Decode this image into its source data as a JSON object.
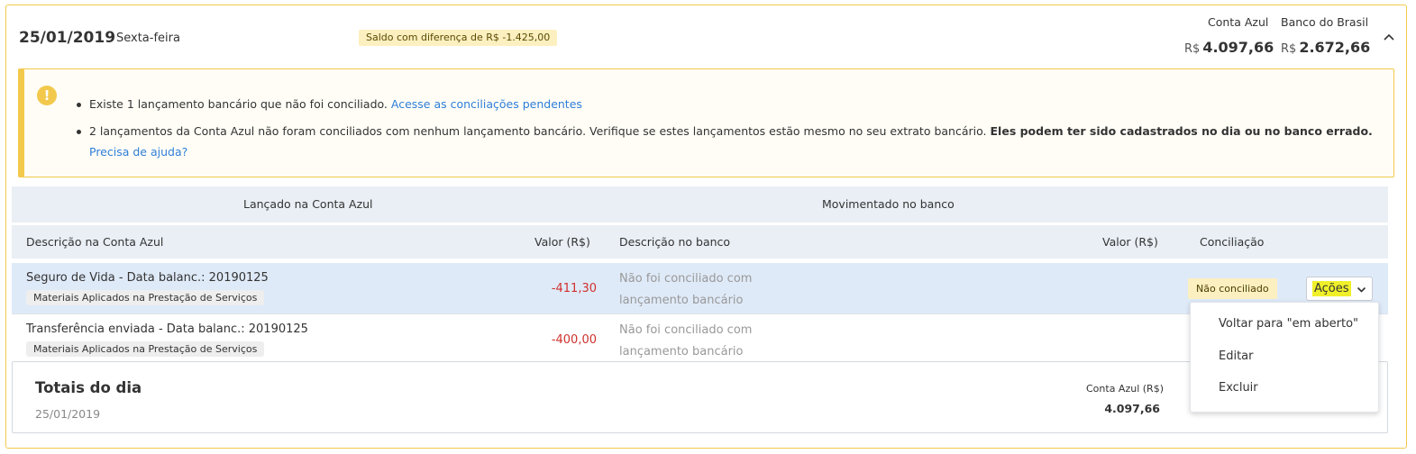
{
  "header": {
    "date": "25/01/2019",
    "weekday": "Sexta-feira",
    "difference_badge": "Saldo com diferença de R$ -1.425,00",
    "balances": [
      {
        "label": "Conta Azul",
        "currency": "R$",
        "value": "4.097,66"
      },
      {
        "label": "Banco do Brasil",
        "currency": "R$",
        "value": "2.672,66"
      }
    ],
    "collapse_icon": "chevron-up-icon"
  },
  "alert": {
    "icon": "exclamation-icon",
    "item1_text": "Existe 1 lançamento bancário que não foi conciliado.",
    "item1_link": "Acesse as conciliações pendentes",
    "item2_text": "2 lançamentos da Conta Azul não foram conciliados com nenhum lançamento bancário. Verifique se estes lançamentos estão mesmo no seu extrato bancário.",
    "item2_bold": "Eles podem ter sido cadastrados no dia ou no banco errado.",
    "item2_link": "Precisa de ajuda?"
  },
  "table": {
    "group_headers": [
      "Lançado na Conta Azul",
      "Movimentado no banco"
    ],
    "columns": [
      "Descrição na Conta Azul",
      "Valor (R$)",
      "Descrição no banco",
      "Valor (R$)",
      "Conciliação"
    ],
    "rows": [
      {
        "description": "Seguro de Vida - Data balanc.: 20190125",
        "category": "Materiais Aplicados na Prestação de Serviços",
        "value": "-411,30",
        "bank_desc_line1": "Não foi conciliado com",
        "bank_desc_line2": "lançamento bancário",
        "status": "Não conciliado",
        "actions_label": "Ações"
      },
      {
        "description": "Transferência enviada - Data balanc.: 20190125",
        "category": "Materiais Aplicados na Prestação de Serviços",
        "value": "-400,00",
        "bank_desc_line1": "Não foi conciliado com",
        "bank_desc_line2": "lançamento bancário"
      }
    ]
  },
  "totals": {
    "title": "Totais do dia",
    "date": "25/01/2019",
    "conta_azul_label": "Conta Azul (R$)",
    "conta_azul_value": "4.097,66"
  },
  "actions_menu": {
    "items": [
      "Voltar para \"em aberto\"",
      "Editar",
      "Excluir"
    ]
  },
  "colors": {
    "accent_yellow": "#f2c94c",
    "negative_red": "#d0312d",
    "link_blue": "#2f7ed8",
    "selected_row": "#dfeaf8"
  }
}
